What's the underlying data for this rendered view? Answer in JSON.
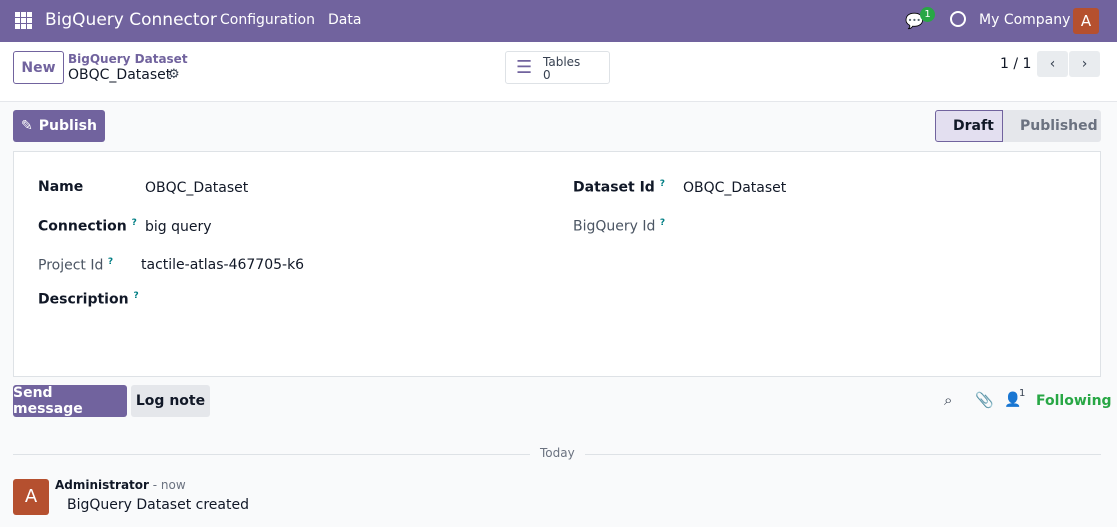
{
  "navbar": {
    "app_name": "BigQuery Connector",
    "menu": [
      "Configuration",
      "Data"
    ],
    "messages_count": "1",
    "company": "My Company",
    "avatar_letter": "A"
  },
  "control": {
    "new_label": "New",
    "breadcrumb_parent": "BigQuery Dataset",
    "record_name": "OBQC_Dataset",
    "smart_button": {
      "label": "Tables",
      "value": "0"
    },
    "pager": "1 / 1"
  },
  "statusbar": {
    "publish_label": "Publish",
    "stages": [
      "Draft",
      "Published"
    ],
    "active_stage": "Draft"
  },
  "form": {
    "name_label": "Name",
    "name_value": "OBQC_Dataset",
    "connection_label": "Connection",
    "connection_value": "big query",
    "project_label": "Project Id",
    "project_value": "tactile-atlas-467705-k6",
    "description_label": "Description",
    "dataset_label": "Dataset Id",
    "dataset_value": "OBQC_Dataset",
    "bigquery_label": "BigQuery Id",
    "help": "?"
  },
  "chatter": {
    "send_label": "Send message",
    "log_label": "Log note",
    "followers_count": "1",
    "following_label": "Following",
    "date_sep": "Today",
    "message": {
      "author": "Administrator",
      "time": "- now",
      "body": "BigQuery Dataset created",
      "avatar_letter": "A"
    }
  }
}
